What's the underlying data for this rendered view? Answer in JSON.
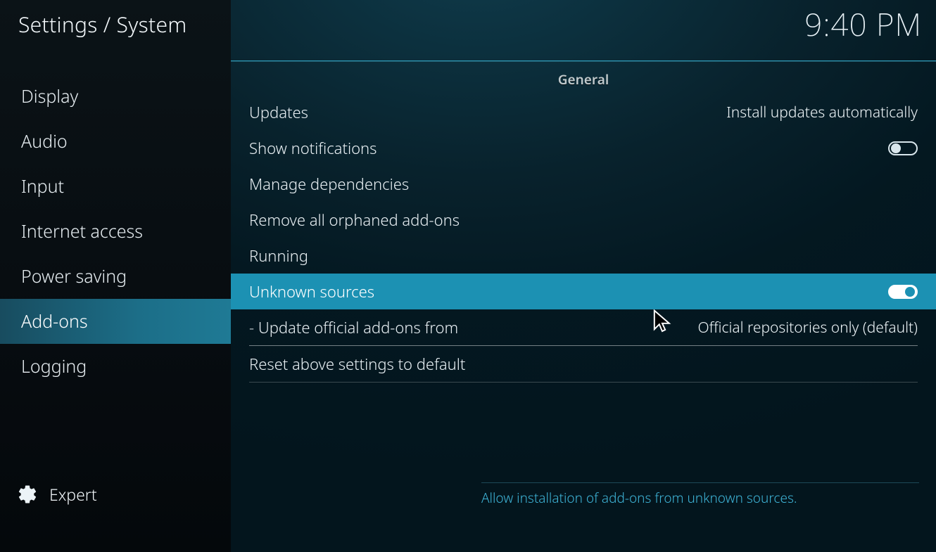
{
  "header": {
    "breadcrumb": "Settings / System",
    "clock": "9:40 PM"
  },
  "sidebar": {
    "items": [
      {
        "label": "Display"
      },
      {
        "label": "Audio"
      },
      {
        "label": "Input"
      },
      {
        "label": "Internet access"
      },
      {
        "label": "Power saving"
      },
      {
        "label": "Add-ons",
        "selected": true
      },
      {
        "label": "Logging"
      }
    ],
    "level": {
      "label": "Expert",
      "icon_name": "gear"
    }
  },
  "main": {
    "section_title": "General",
    "rows": {
      "updates": {
        "label": "Updates",
        "value": "Install updates automatically"
      },
      "notifications": {
        "label": "Show notifications",
        "toggle": "off"
      },
      "manage_dep": {
        "label": "Manage dependencies"
      },
      "remove_orphan": {
        "label": "Remove all orphaned add-ons"
      },
      "running": {
        "label": "Running"
      },
      "unknown": {
        "label": "Unknown sources",
        "toggle": "on",
        "highlight": true
      },
      "update_from": {
        "label": "Update official add-ons from",
        "value": "Official repositories only (default)",
        "indent": true
      },
      "reset": {
        "label": "Reset above settings to default"
      }
    },
    "hint": "Allow installation of add-ons from unknown sources."
  }
}
